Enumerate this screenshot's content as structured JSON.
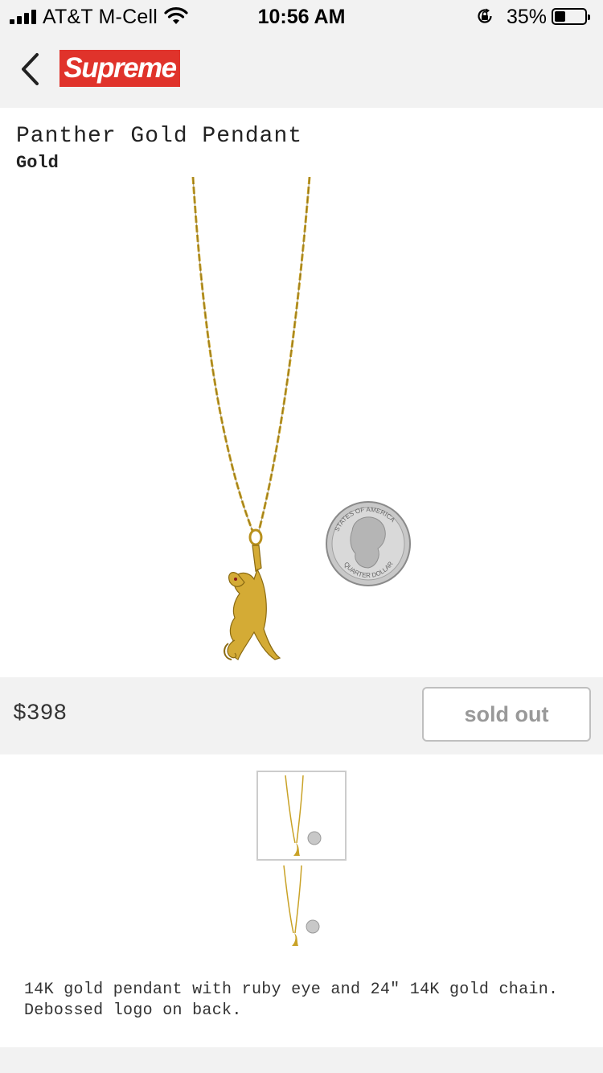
{
  "status_bar": {
    "carrier": "AT&T M-Cell",
    "time": "10:56 AM",
    "battery_percent": "35%",
    "battery_level": 0.35,
    "icons": [
      "signal-icon",
      "wifi-icon",
      "rotation-lock-icon",
      "battery-icon"
    ]
  },
  "nav": {
    "back_icon": "chevron-left-icon",
    "logo_text": "Supreme",
    "logo_color": "#e0332b"
  },
  "product": {
    "title": "Panther Gold Pendant",
    "style": "Gold",
    "price": "$398",
    "button_label": "sold out",
    "description": "14K gold pendant with ruby eye and 24\" 14K gold chain. Debossed logo on back."
  },
  "coin": {
    "text_top": "STATES OF AMERICA",
    "text_bottom": "QUARTER DOLLAR"
  },
  "colors": {
    "gold": "#c9a227",
    "button_text": "#999999",
    "background": "#f2f2f2"
  }
}
